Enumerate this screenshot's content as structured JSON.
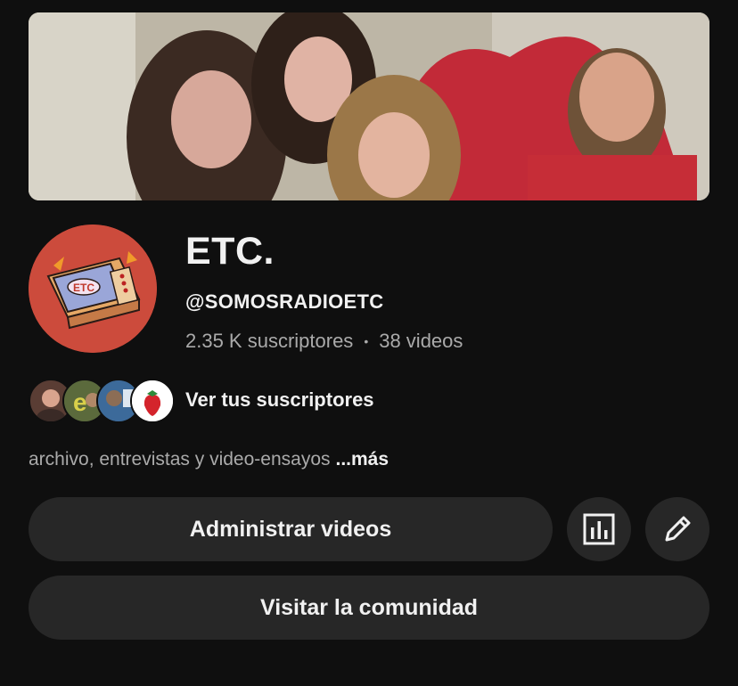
{
  "channel": {
    "name": "ETC.",
    "handle": "@SOMOSRADIOETC",
    "subscribers": "2.35 K suscriptores",
    "stats_separator": "•",
    "videos": "38 videos",
    "description": "archivo, entrevistas y video-ensayos",
    "more_label": "...más",
    "logo_text": "ETC"
  },
  "subscribers_row": {
    "label": "Ver tus suscriptores"
  },
  "actions": {
    "manage_videos": "Administrar videos",
    "visit_community": "Visitar la comunidad",
    "analytics_icon": "bar-chart-icon",
    "edit_icon": "pencil-icon"
  },
  "colors": {
    "background": "#0f0f0f",
    "button": "#272727",
    "secondary_text": "#aaaaaa",
    "avatar_bg": "#cc4b3c"
  }
}
